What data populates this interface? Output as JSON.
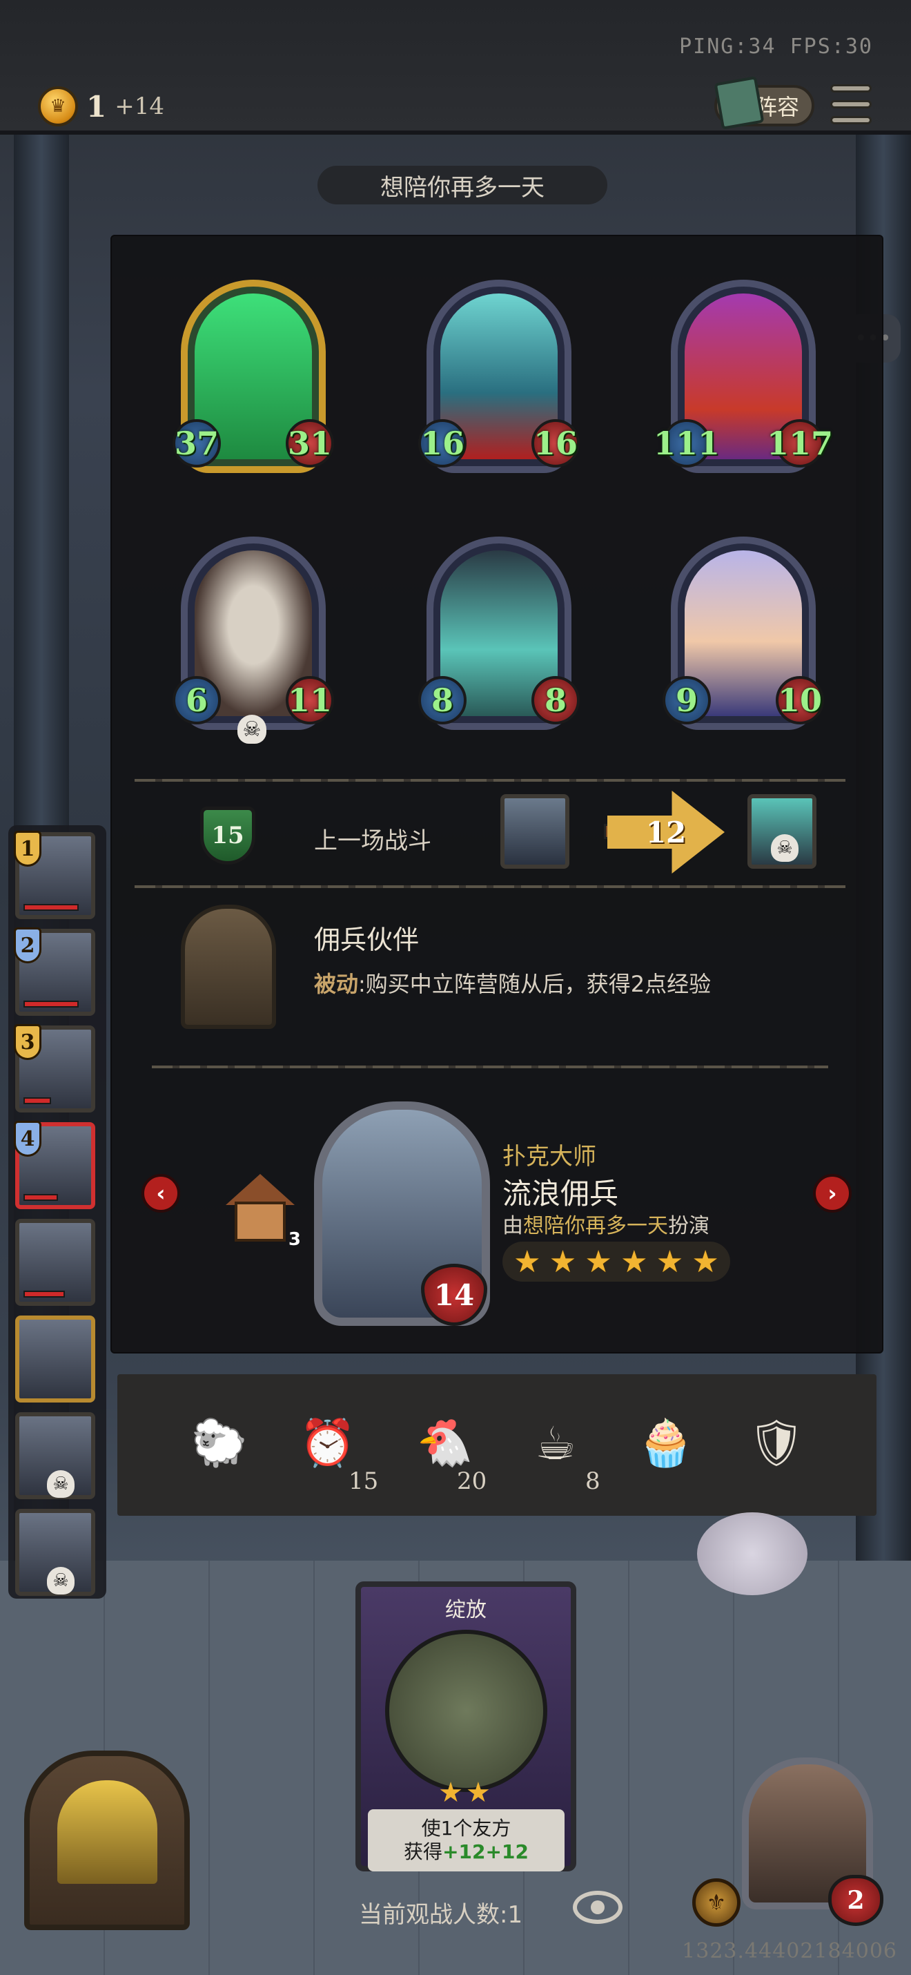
{
  "top_bar": {
    "ping_fps": "PING:34   FPS:30",
    "gold": "1",
    "gold_income": "+14",
    "lineup_label": "阵容"
  },
  "title": "想陪你再多一天",
  "board": {
    "minions": [
      {
        "attack": "37",
        "health": "31",
        "golden": true
      },
      {
        "attack": "16",
        "health": "16",
        "golden": false
      },
      {
        "attack": "111",
        "health": "117",
        "golden": false
      },
      {
        "attack": "6",
        "health": "11",
        "golden": false
      },
      {
        "attack": "8",
        "health": "8",
        "golden": false
      },
      {
        "attack": "9",
        "health": "10",
        "golden": false
      }
    ]
  },
  "last_battle": {
    "tier": "15",
    "label": "上一场战斗",
    "damage": "12"
  },
  "hero_power": {
    "name": "佣兵伙伴",
    "desc_prefix": "被动",
    "desc": ":购买中立阵营随从后，获得2点经验"
  },
  "hero": {
    "title": "扑克大师",
    "name": "流浪佣兵",
    "played_by_prefix": "由",
    "player": "想陪你再多一天",
    "played_by_suffix": "扮演",
    "health": "14",
    "star_count": 6,
    "building_count": "3"
  },
  "tray": {
    "items": [
      {
        "icon": "sheep-icon",
        "count": ""
      },
      {
        "icon": "alarm-clock-icon",
        "count": "15"
      },
      {
        "icon": "chicken-icon",
        "count": "20"
      },
      {
        "icon": "teacup-icon",
        "count": "8"
      },
      {
        "icon": "cupcake-icon",
        "count": ""
      },
      {
        "icon": "shield-icon",
        "count": ""
      }
    ]
  },
  "sidebar": {
    "players": [
      {
        "rank": "1"
      },
      {
        "rank": "2"
      },
      {
        "rank": "3"
      },
      {
        "rank": "4"
      },
      {
        "rank": ""
      },
      {
        "rank": ""
      },
      {
        "rank": ""
      },
      {
        "rank": ""
      }
    ]
  },
  "spell_card": {
    "name": "绽放",
    "desc_line1": "使1个友方",
    "desc_line2_prefix": "获得",
    "desc_atk": "+12",
    "desc_hp": "+12"
  },
  "player": {
    "health": "2"
  },
  "viewers": {
    "label": "当前观战人数:1"
  },
  "footer_id": "1323.44402184006",
  "colors": {
    "gold_accent": "#d6b35a",
    "stat_green": "#9cf08a",
    "red_button": "#b3201e"
  }
}
